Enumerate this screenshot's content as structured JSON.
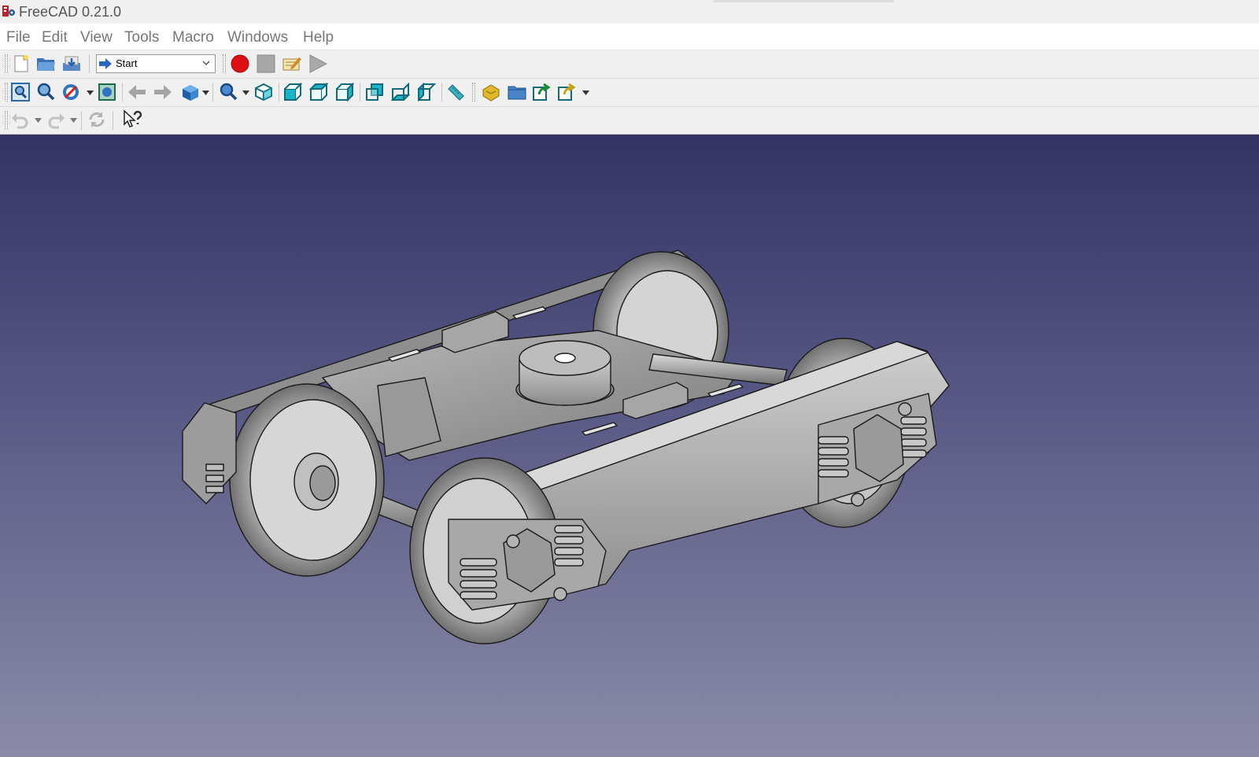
{
  "window": {
    "title": "FreeCAD 0.21.0"
  },
  "menu": {
    "items": [
      {
        "label": "File"
      },
      {
        "label": "Edit"
      },
      {
        "label": "View"
      },
      {
        "label": "Tools"
      },
      {
        "label": "Macro"
      },
      {
        "label": "Windows"
      },
      {
        "label": "Help"
      }
    ]
  },
  "toolbar_file": {
    "workbench_selected": "Start"
  },
  "icons": {
    "macro_record": "record-icon",
    "macro_stop": "stop-icon",
    "macro_edit": "macro-edit-icon",
    "macro_run": "play-icon"
  },
  "colors": {
    "viewport_top": "#333366",
    "viewport_bottom": "#8b8ba8",
    "record": "#dd1111",
    "view_cube": "#19b4c8"
  }
}
